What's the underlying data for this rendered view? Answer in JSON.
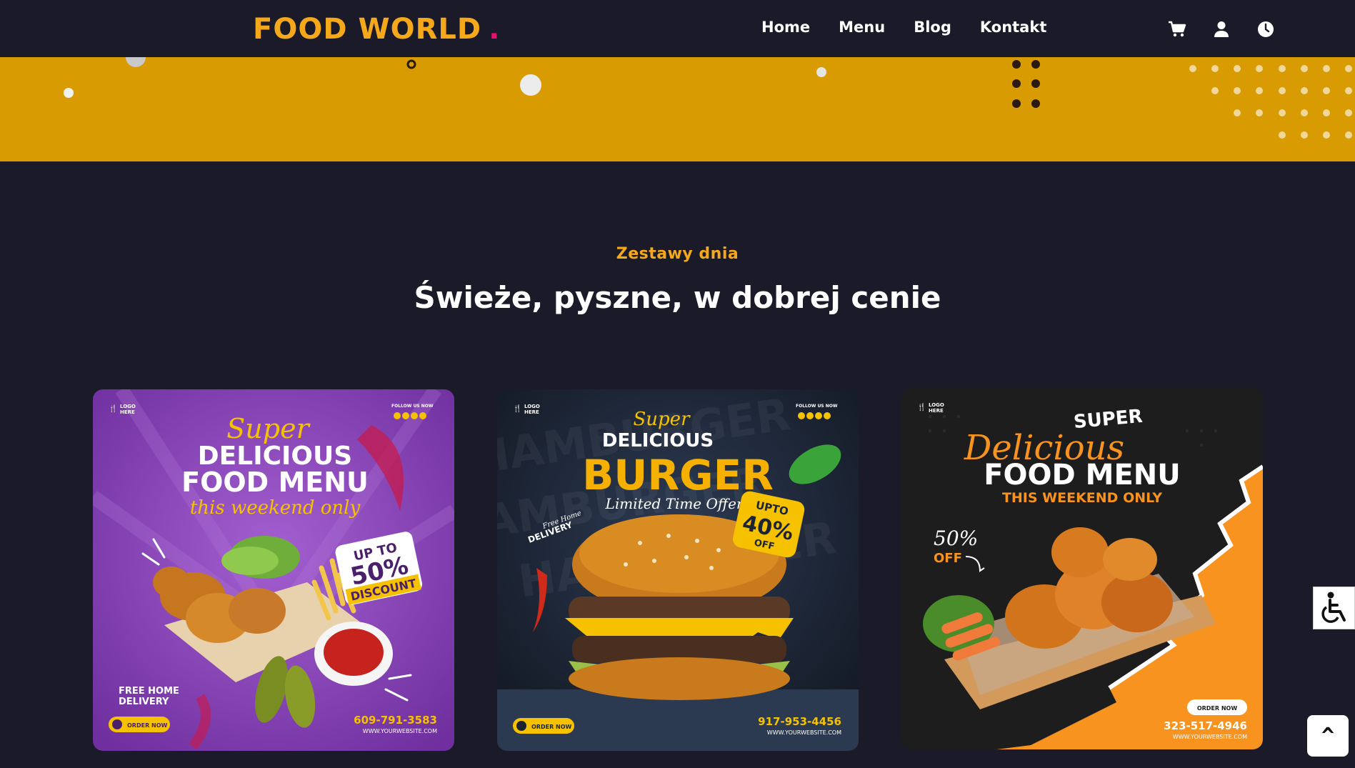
{
  "brand": {
    "name": "FOOD WORLD",
    "dot": ".",
    "color": "#f6a81b",
    "dot_color": "#e6106e"
  },
  "nav": {
    "links": [
      "Home",
      "Menu",
      "Blog",
      "Kontakt"
    ],
    "icons": [
      "cart-icon",
      "user-icon",
      "clock-icon"
    ]
  },
  "section": {
    "subtitle": "Zestawy dnia",
    "title": "Świeże, pyszne, w dobrej cenie"
  },
  "cards": [
    {
      "logo": [
        "LOGO",
        "HERE"
      ],
      "follow": "FOLLOW US NOW",
      "line1": "Super",
      "line2": "DELICIOUS",
      "line3": "FOOD MENU",
      "line4": "this weekend only",
      "badge": [
        "UP TO",
        "50%",
        "DISCOUNT"
      ],
      "delivery": [
        "FREE HOME",
        "DELIVERY"
      ],
      "cta": "ORDER NOW",
      "phone": "609-791-3583",
      "website": "WWW.YOURWEBSITE.COM",
      "bg": "#8a45b5"
    },
    {
      "logo": [
        "LOGO",
        "HERE"
      ],
      "follow": "FOLLOW US NOW",
      "line1": "Super",
      "line2": "DELICIOUS",
      "line3": "BURGER",
      "line4": "Limited Time Offer",
      "badge": [
        "UPTO",
        "40%",
        "OFF"
      ],
      "delivery": [
        "Free Home",
        "DELIVERY"
      ],
      "cta": "ORDER NOW",
      "phone": "917-953-4456",
      "website": "WWW.YOURWEBSITE.COM",
      "bg_text": "HAMBURGER",
      "bg": "#1c2433"
    },
    {
      "logo": [
        "LOGO",
        "HERE"
      ],
      "line1": "SUPER",
      "line2": "Delicious",
      "line3": "FOOD MENU",
      "line4": "THIS WEEKEND ONLY",
      "badge": [
        "50%",
        "OFF"
      ],
      "cta": "ORDER NOW",
      "phone": "323-517-4946",
      "website": "WWW.YOURWEBSITE.COM",
      "bg": "#1d1d1d",
      "accent": "#f7931e"
    }
  ],
  "floating": {
    "scroll_top": "^",
    "accessibility": "accessibility-icon"
  }
}
